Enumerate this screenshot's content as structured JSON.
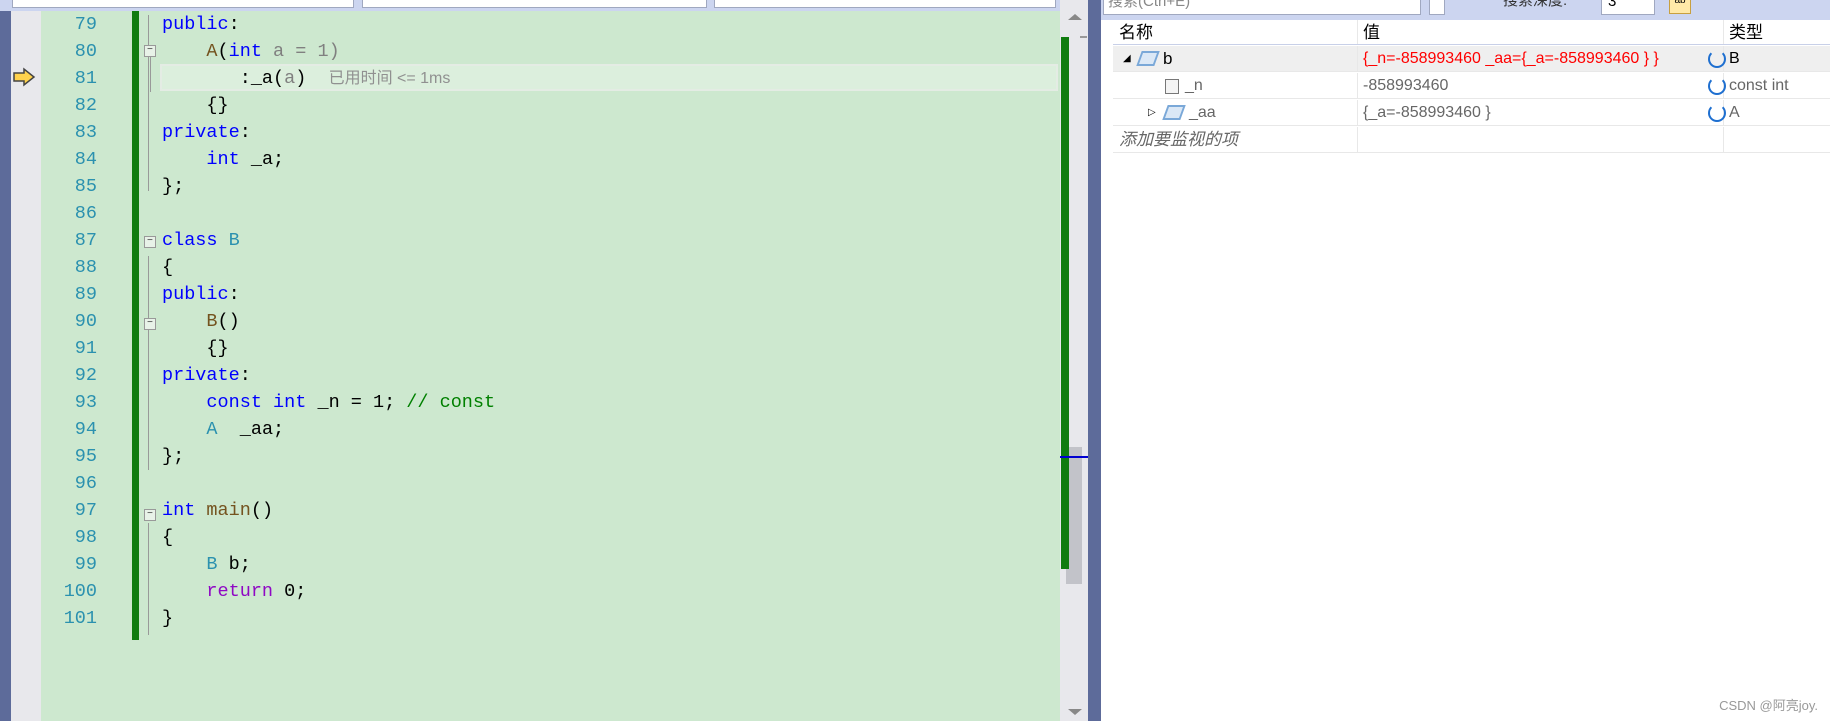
{
  "editor": {
    "lines": [
      {
        "n": "79",
        "tokens": [
          [
            "kw",
            "public"
          ],
          [
            "",
            "："
          ]
        ]
      },
      {
        "n": "80"
      },
      {
        "n": "81"
      },
      {
        "n": "82"
      },
      {
        "n": "83"
      },
      {
        "n": "84"
      },
      {
        "n": "85"
      },
      {
        "n": "86"
      },
      {
        "n": "87"
      },
      {
        "n": "88"
      },
      {
        "n": "89"
      },
      {
        "n": "90"
      },
      {
        "n": "91"
      },
      {
        "n": "92"
      },
      {
        "n": "93"
      },
      {
        "n": "94"
      },
      {
        "n": "95"
      },
      {
        "n": "96"
      },
      {
        "n": "97"
      },
      {
        "n": "98"
      },
      {
        "n": "99"
      },
      {
        "n": "100"
      },
      {
        "n": "101"
      }
    ],
    "code": {
      "l79": "public",
      "l80_a": "A",
      "l80_int": "int",
      "l80_rest": " a = 1)",
      "l81_a": ":_a(",
      "l81_p": "a",
      "l81_c": ")",
      "l81_hint": "已用时间 <= 1ms",
      "l82": "{}",
      "l83": "private",
      "l84_int": "int",
      "l84_rest": " _a;",
      "l85": "};",
      "l87_kw": "class",
      "l87_ty": "B",
      "l88": "{",
      "l89": "public",
      "l90_fn": "B",
      "l90_rest": "()",
      "l91": "{}",
      "l92": "private",
      "l93_const": "const",
      "l93_int": "int",
      "l93_rest": " _n = 1; ",
      "l93_cm": "// const",
      "l94_ty": "A",
      "l94_rest": "  _aa;",
      "l95": "};",
      "l97_int": "int",
      "l97_fn": "main",
      "l97_rest": "()",
      "l98": "{",
      "l99_ty": "B",
      "l99_rest": " b;",
      "l100_ret": "return",
      "l100_rest": " 0;",
      "l101": "}"
    },
    "colon": ":"
  },
  "watch": {
    "search_placeholder": "搜索(Ctrl+E)",
    "depth_label": "搜索深度:",
    "depth_value": "3",
    "headers": {
      "name": "名称",
      "value": "值",
      "type": "类型"
    },
    "rows": [
      {
        "name": "b",
        "value": "{_n=-858993460 _aa={_a=-858993460 } }",
        "type": "B",
        "value_color": "#ff0000"
      },
      {
        "name": "_n",
        "value": "-858993460",
        "type": "const int"
      },
      {
        "name": "_aa",
        "value": "{_a=-858993460 }",
        "type": "A"
      }
    ],
    "add_item": "添加要监视的项"
  },
  "watermark": "CSDN @阿亮joy."
}
